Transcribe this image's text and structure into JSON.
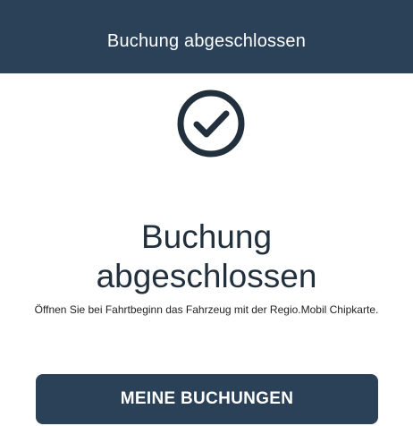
{
  "header": {
    "title": "Buchung abgeschlossen"
  },
  "confirmation": {
    "icon": "check-circle-icon",
    "title_line1": "Buchung",
    "title_line2": "abgeschlossen",
    "message": "Öffnen Sie bei Fahrtbeginn das Fahrzeug mit der Regio.Mobil Chipkarte."
  },
  "actions": {
    "my_bookings_label": "MEINE BUCHUNGEN"
  },
  "colors": {
    "header_bg": "#2b4158",
    "button_bg": "#2b4158",
    "icon": "#22303d",
    "background": "#ffffff"
  }
}
